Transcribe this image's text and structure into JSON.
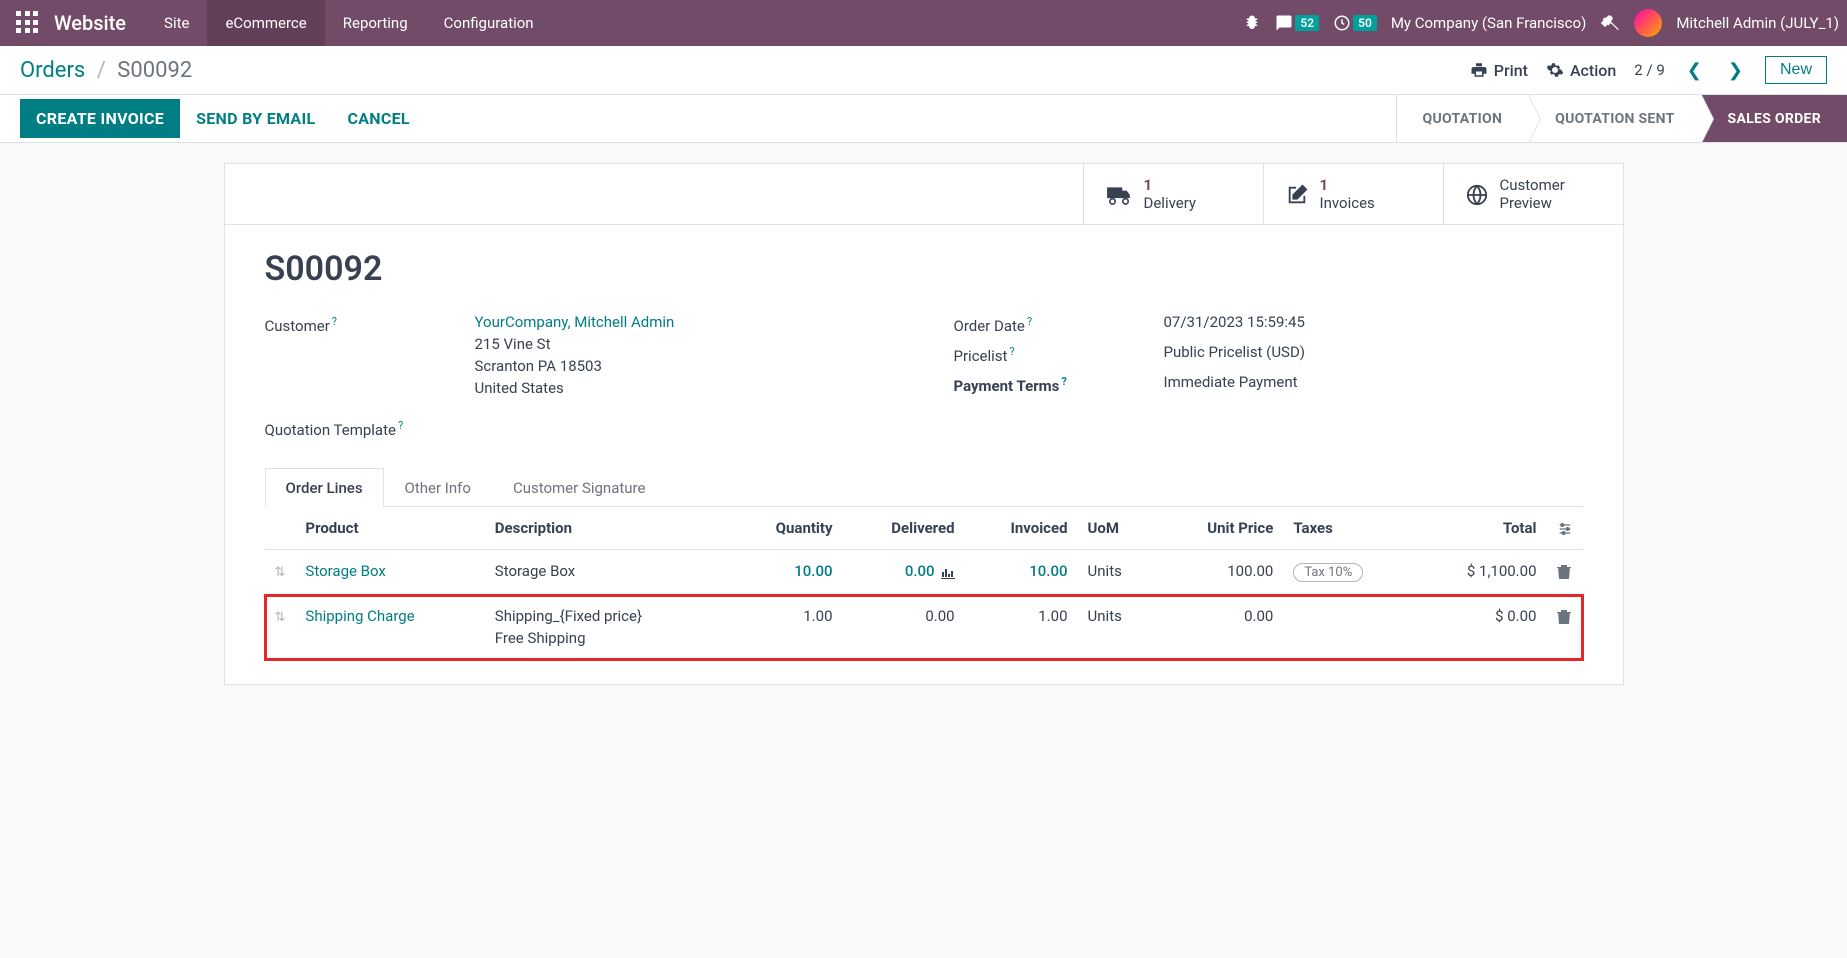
{
  "topnav": {
    "brand": "Website",
    "items": [
      "Site",
      "eCommerce",
      "Reporting",
      "Configuration"
    ],
    "active_index": 1,
    "messages_badge": "52",
    "activities_badge": "50",
    "company": "My Company (San Francisco)",
    "user": "Mitchell Admin (JULY_1)"
  },
  "controlbar": {
    "breadcrumb_root": "Orders",
    "breadcrumb_current": "S00092",
    "print": "Print",
    "action": "Action",
    "pager": "2 / 9",
    "new": "New"
  },
  "statusbar": {
    "create_invoice": "CREATE INVOICE",
    "send_email": "SEND BY EMAIL",
    "cancel": "CANCEL",
    "steps": [
      "QUOTATION",
      "QUOTATION SENT",
      "SALES ORDER"
    ],
    "active_step": 2
  },
  "stats": {
    "delivery_count": "1",
    "delivery_label": "Delivery",
    "invoice_count": "1",
    "invoice_label": "Invoices",
    "preview_label": "Customer\nPreview"
  },
  "record": {
    "title": "S00092",
    "customer_label": "Customer",
    "customer_name": "YourCompany, Mitchell Admin",
    "customer_addr1": "215 Vine St",
    "customer_addr2": "Scranton PA 18503",
    "customer_addr3": "United States",
    "quotation_template_label": "Quotation Template",
    "order_date_label": "Order Date",
    "order_date": "07/31/2023 15:59:45",
    "pricelist_label": "Pricelist",
    "pricelist": "Public Pricelist (USD)",
    "payment_terms_label": "Payment Terms",
    "payment_terms": "Immediate Payment"
  },
  "tabs": [
    "Order Lines",
    "Other Info",
    "Customer Signature"
  ],
  "active_tab": 0,
  "columns": {
    "product": "Product",
    "description": "Description",
    "quantity": "Quantity",
    "delivered": "Delivered",
    "invoiced": "Invoiced",
    "uom": "UoM",
    "unit_price": "Unit Price",
    "taxes": "Taxes",
    "total": "Total"
  },
  "lines": [
    {
      "product": "Storage Box",
      "description": "Storage Box",
      "description2": "",
      "quantity": "10.00",
      "delivered": "0.00",
      "show_graph": true,
      "invoiced": "10.00",
      "uom": "Units",
      "unit_price": "100.00",
      "tax": "Tax 10%",
      "total": "$ 1,100.00",
      "highlight": false,
      "qty_link": true
    },
    {
      "product": "Shipping Charge",
      "description": "Shipping_{Fixed price}",
      "description2": "Free Shipping",
      "quantity": "1.00",
      "delivered": "0.00",
      "show_graph": false,
      "invoiced": "1.00",
      "uom": "Units",
      "unit_price": "0.00",
      "tax": "",
      "total": "$ 0.00",
      "highlight": true,
      "qty_link": false
    }
  ]
}
